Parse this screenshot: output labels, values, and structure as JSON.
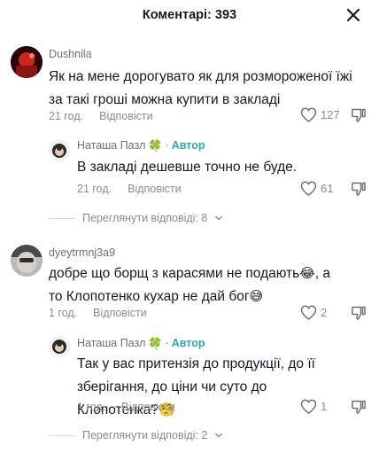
{
  "header": {
    "title": "Коментарі: 393"
  },
  "comments": [
    {
      "author": "Dushnila",
      "text": "Як на мене дорогувато як для розмороженої їжі за такі гроші можна купити в закладі",
      "time": "21 год.",
      "reply_label": "Відповісти",
      "likes": "127",
      "reply": {
        "author": "Наташа Пазл",
        "badge": "🍀",
        "separator": "·",
        "role": "Автор",
        "text": "В закладі дешевше точно не буде.",
        "time": "21 год.",
        "reply_label": "Відповісти",
        "likes": "61"
      },
      "view_replies": "Переглянути відповіді: 8"
    },
    {
      "author": "dyeytrmnj3a9",
      "text_part1": "добре що борщ з карасями не подають",
      "emoji1": "😂",
      "text_part2": ", а то Клопотенко кухар не дай бог",
      "emoji2": "😅",
      "time": "1 год.",
      "reply_label": "Відповісти",
      "likes": "2",
      "reply": {
        "author": "Наташа Пазл",
        "badge": "🍀",
        "separator": "·",
        "role": "Автор",
        "text": "Так у вас притензія до продукції, до її зберігання, до ціни чи суто до Клопотенка?",
        "emoji": "🧐",
        "time": "1 год.",
        "reply_label": "Відповісти",
        "likes": "1"
      },
      "view_replies": "Переглянути відповіді: 2"
    }
  ],
  "icons": {
    "close": "close-icon",
    "heart": "heart-outline-icon",
    "dislike": "thumbs-down-icon",
    "chevron": "chevron-down-icon"
  },
  "colors": {
    "author_role": "#2ba7b4",
    "meta_text": "#8a8b91",
    "primary_text": "#161823"
  }
}
